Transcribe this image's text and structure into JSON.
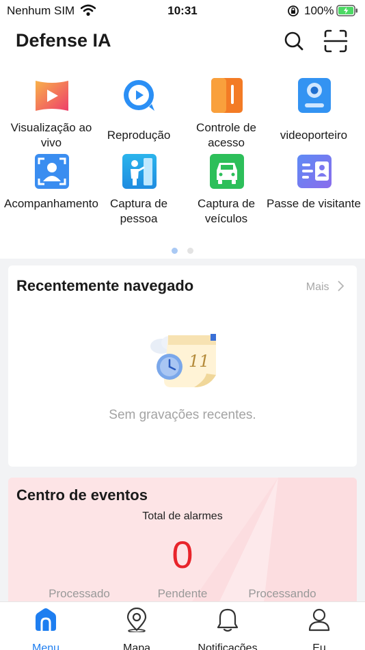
{
  "status_bar": {
    "carrier": "Nenhum SIM",
    "time": "10:31",
    "battery": "100%"
  },
  "header": {
    "title": "Defense IA",
    "actions": [
      "search-icon",
      "scan-icon"
    ]
  },
  "features": [
    {
      "label": "Visualização ao vivo",
      "icon": "live-view-icon",
      "color": "#f5744a"
    },
    {
      "label": "Reprodução",
      "icon": "playback-icon",
      "color": "#2b8ff5"
    },
    {
      "label": "Controle de acesso",
      "icon": "access-control-icon",
      "color": "#f5822a"
    },
    {
      "label": "videoporteiro",
      "icon": "video-intercom-icon",
      "color": "#2f8ef2"
    },
    {
      "label": "Acompanhamento",
      "icon": "person-tracking-icon",
      "color": "#2f8ef2"
    },
    {
      "label": "Captura de pessoa",
      "icon": "person-capture-icon",
      "color": "#28a6e6"
    },
    {
      "label": "Captura de veículos",
      "icon": "vehicle-capture-icon",
      "color": "#2dbf5a"
    },
    {
      "label": "Passe de visitante",
      "icon": "visitor-pass-icon",
      "color": "#6d7cf0"
    }
  ],
  "pager": {
    "pages": 2,
    "current": 1
  },
  "recent": {
    "title": "Recentemente navegado",
    "more": "Mais",
    "empty_text": "Sem gravações recentes.",
    "illustration_day": "11"
  },
  "events": {
    "title": "Centro de eventos",
    "total_label": "Total de alarmes",
    "total_value": "0",
    "stats": [
      "Processado",
      "Pendente",
      "Processando"
    ]
  },
  "tabs": [
    {
      "label": "Menu",
      "icon": "home-icon",
      "active": true
    },
    {
      "label": "Mapa",
      "icon": "map-pin-icon",
      "active": false
    },
    {
      "label": "Notificações",
      "icon": "bell-icon",
      "active": false
    },
    {
      "label": "Eu",
      "icon": "user-icon",
      "active": false
    }
  ],
  "colors": {
    "accent": "#1e7ef0",
    "alarm": "#e8242b",
    "events_bg": "#fde4e6"
  }
}
